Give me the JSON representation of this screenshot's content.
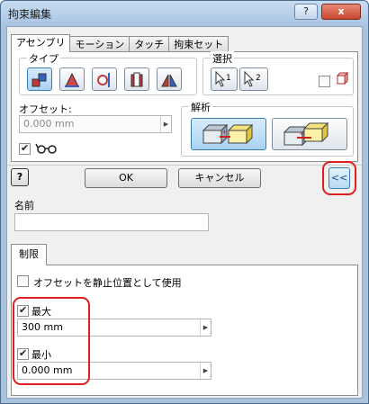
{
  "window": {
    "title": "拘束編集",
    "help_button": "?",
    "close_button": "x"
  },
  "tabs": [
    "アセンブリ",
    "モーション",
    "タッチ",
    "拘束セット"
  ],
  "type_group": {
    "label": "タイプ",
    "buttons": [
      "mate-icon",
      "angle-icon",
      "tangent-icon",
      "insert-icon",
      "symmetry-icon"
    ]
  },
  "selection_group": {
    "label": "選択",
    "buttons": [
      "1",
      "2"
    ]
  },
  "offset": {
    "label": "オフセット:",
    "value": "0.000 mm",
    "glasses_checked": true
  },
  "solution_group": {
    "label": "解析"
  },
  "dialog_buttons": {
    "ok": "OK",
    "cancel": "キャンセル",
    "collapse": "<<"
  },
  "name_section": {
    "label": "名前",
    "value": ""
  },
  "limits_tab": {
    "label": "制限"
  },
  "limits": {
    "use_offset_resting": {
      "label": "オフセットを静止位置として使用",
      "checked": false
    },
    "max": {
      "label": "最大",
      "checked": true,
      "value": "300 mm"
    },
    "min": {
      "label": "最小",
      "checked": true,
      "value": "0.000 mm"
    }
  }
}
